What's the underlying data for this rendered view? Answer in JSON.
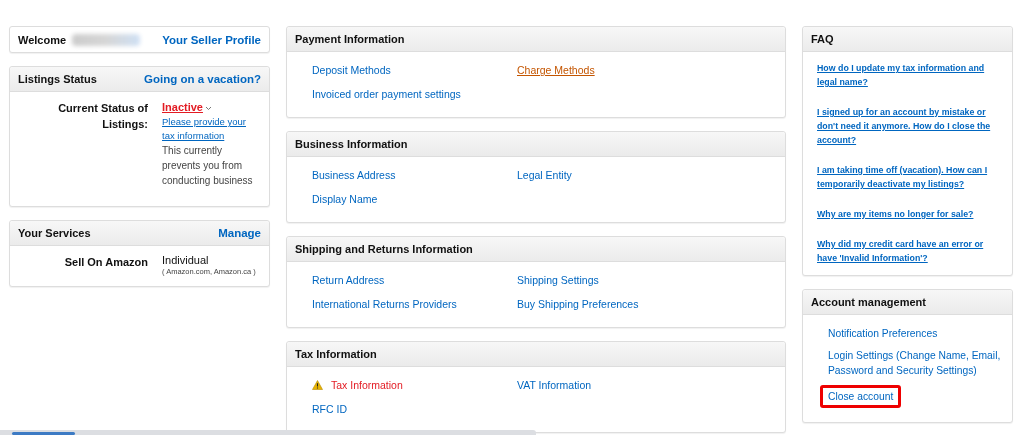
{
  "welcome": {
    "label": "Welcome",
    "link": "Your Seller Profile"
  },
  "listings_status": {
    "title": "Listings Status",
    "action": "Going on a vacation?",
    "label": "Current Status of Listings:",
    "status": "Inactive",
    "status_link": "Please provide your tax information",
    "note": "This currently prevents you from conducting business"
  },
  "services": {
    "title": "Your Services",
    "action": "Manage",
    "rows": [
      {
        "label": "Sell On Amazon",
        "value": "Individual",
        "detail": "( Amazon.com, Amazon.ca )"
      }
    ]
  },
  "sections": [
    {
      "title": "Payment Information",
      "links": [
        {
          "label": "Deposit Methods",
          "kind": "link"
        },
        {
          "label": "Charge Methods",
          "kind": "hover"
        },
        {
          "label": "Invoiced order payment settings",
          "kind": "link"
        }
      ]
    },
    {
      "title": "Business Information",
      "links": [
        {
          "label": "Business Address",
          "kind": "link"
        },
        {
          "label": "Legal Entity",
          "kind": "link"
        },
        {
          "label": "Display Name",
          "kind": "link"
        }
      ]
    },
    {
      "title": "Shipping and Returns Information",
      "links": [
        {
          "label": "Return Address",
          "kind": "link"
        },
        {
          "label": "Shipping Settings",
          "kind": "link"
        },
        {
          "label": "International Returns Providers",
          "kind": "link"
        },
        {
          "label": "Buy Shipping Preferences",
          "kind": "link"
        }
      ]
    },
    {
      "title": "Tax Information",
      "links": [
        {
          "label": "Tax Information",
          "kind": "warning"
        },
        {
          "label": "VAT Information",
          "kind": "link"
        },
        {
          "label": "RFC ID",
          "kind": "link"
        }
      ]
    }
  ],
  "faq": {
    "title": "FAQ",
    "items": [
      "How do I update my tax information and legal name?",
      "I signed up for an account by mistake or don't need it anymore. How do I close the account?",
      "I am taking time off (vacation). How can I temporarily deactivate my listings?",
      "Why are my items no longer for sale?",
      "Why did my credit card have an error or have 'Invalid Information'?"
    ]
  },
  "account_management": {
    "title": "Account management",
    "links": [
      {
        "label": "Notification Preferences",
        "outlined": false
      },
      {
        "label": "Login Settings (Change Name, Email, Password and Security Settings)",
        "outlined": false
      },
      {
        "label": "Close account",
        "outlined": true
      }
    ]
  }
}
